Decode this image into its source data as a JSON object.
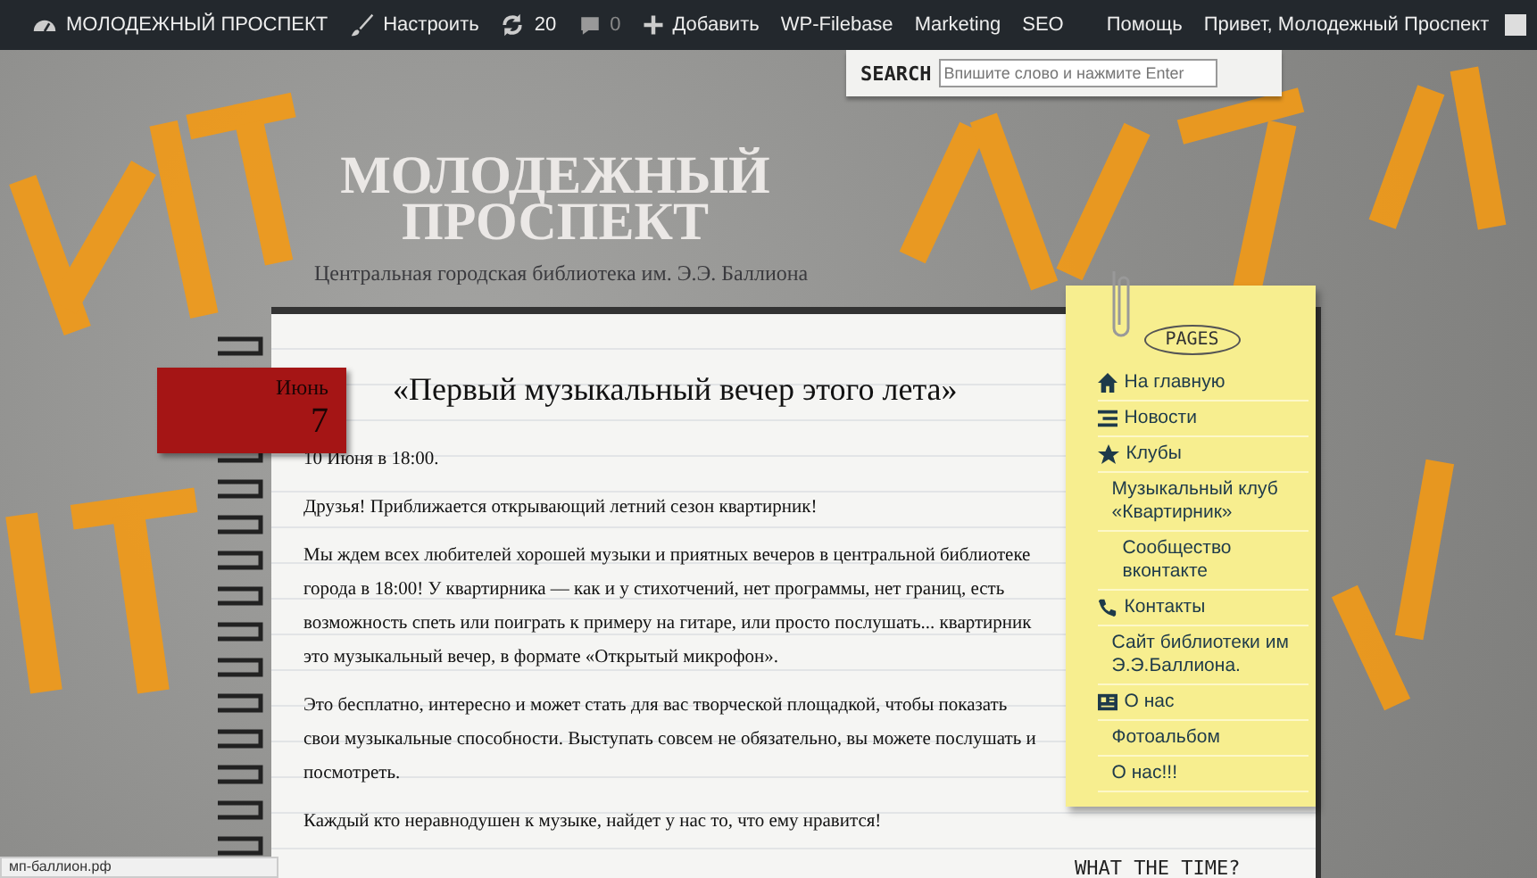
{
  "admin_bar": {
    "items": [
      {
        "kind": "site",
        "label": "МОЛОДЕЖНЫЙ ПРОСПЕКТ"
      },
      {
        "kind": "customize",
        "label": "Настроить"
      },
      {
        "kind": "updates",
        "label": "20"
      },
      {
        "kind": "comments",
        "label": "0"
      },
      {
        "kind": "new",
        "label": "Добавить"
      },
      {
        "kind": "plain",
        "label": "WP-Filebase"
      },
      {
        "kind": "plain",
        "label": "Marketing"
      },
      {
        "kind": "plain",
        "label": "SEO"
      }
    ],
    "help": "Помощь",
    "greeting": "Привет, Молодежный Проспект"
  },
  "search": {
    "label": "SEARCH",
    "placeholder": "Впишите слово и нажмите Enter"
  },
  "header": {
    "title": "МОЛОДЕЖНЫЙ ПРОСПЕКТ",
    "tagline": "Центральная городская библиотека им. Э.Э. Баллиона"
  },
  "post": {
    "month": "Июнь",
    "day": "7",
    "title": "«Первый музыкальный вечер этого лета»",
    "paragraphs": [
      "10 Июня в 18:00.",
      "Друзья! Приближается открывающий летний сезон квартирник!",
      "Мы ждем всех любителей хорошей музыки и приятных вечеров в центральной библиотеке города в 18:00! У квартирника — как и у стихотчений, нет программы, нет границ, есть возможность спеть или поиграть к примеру на гитаре, или просто послушать... квартирник это музыкальный вечер, в формате «Открытый микрофон».",
      "Это бесплатно, интересно и может стать для вас творческой площадкой, чтобы показать свои музыкальные способности. Выступать совсем не обязательно, вы можете послушать и посмотреть.",
      "Каждый кто неравнодушен к музыке, найдет у нас то, что ему нравится!"
    ]
  },
  "sidebar": {
    "heading": "PAGES",
    "items": [
      {
        "label": "На главную"
      },
      {
        "label": "Новости"
      },
      {
        "label": "Клубы",
        "children": [
          {
            "label": "Музыкальный клуб «Квартирник»",
            "children": [
              {
                "label": "Сообщество вконтакте"
              }
            ]
          }
        ]
      },
      {
        "label": "Контакты",
        "children": [
          {
            "label": "Сайт библиотеки им Э.Э.Баллиона."
          }
        ]
      },
      {
        "label": "О нас",
        "children": [
          {
            "label": "Фотоальбом"
          },
          {
            "label": "О нас!!!"
          }
        ]
      }
    ],
    "next_widget_title": "WHAT THE TIME?"
  },
  "status_bar": "мп-баллион.рф"
}
